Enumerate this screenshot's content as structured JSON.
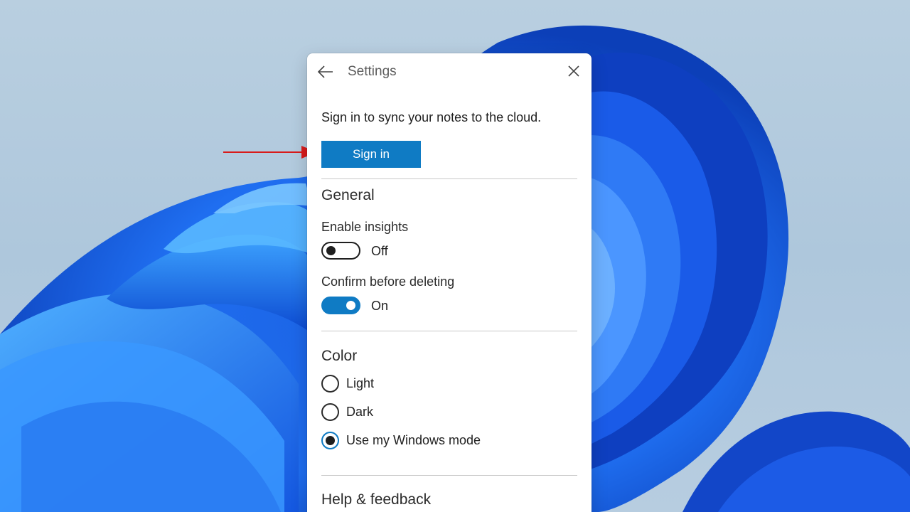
{
  "window": {
    "title": "Settings"
  },
  "account": {
    "sync_message": "Sign in to sync your notes to the cloud.",
    "sign_in_label": "Sign in"
  },
  "general": {
    "heading": "General",
    "enable_insights": {
      "label": "Enable insights",
      "state": "Off"
    },
    "confirm_delete": {
      "label": "Confirm before deleting",
      "state": "On"
    }
  },
  "color": {
    "heading": "Color",
    "options": [
      {
        "label": "Light",
        "selected": false
      },
      {
        "label": "Dark",
        "selected": false
      },
      {
        "label": "Use my Windows mode",
        "selected": true
      }
    ]
  },
  "help": {
    "heading": "Help & feedback"
  },
  "theme": {
    "accent": "#0f7bc4",
    "annotation_arrow": "#d81b1b"
  },
  "icons": {
    "back": "arrow-left-icon",
    "close": "close-icon"
  }
}
